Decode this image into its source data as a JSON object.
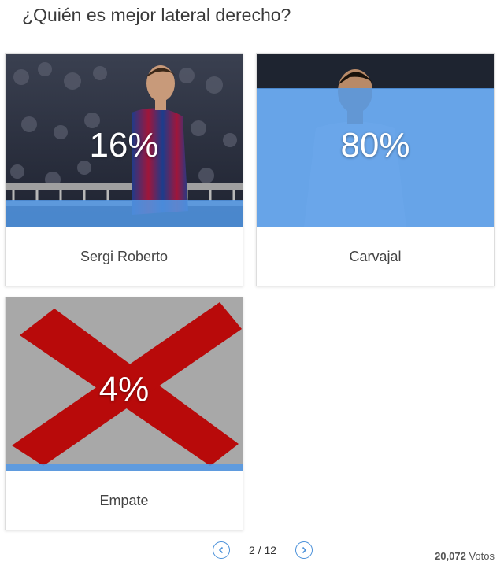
{
  "poll": {
    "question": "¿Quién es mejor lateral derecho?",
    "options": [
      {
        "label": "Sergi Roberto",
        "percent_text": "16%",
        "percent": 16
      },
      {
        "label": "Carvajal",
        "percent_text": "80%",
        "percent": 80
      },
      {
        "label": "Empate",
        "percent_text": "4%",
        "percent": 4
      }
    ]
  },
  "pagination": {
    "indicator": "2 / 12",
    "prev_icon": "chevron-left-icon",
    "next_icon": "chevron-right-icon"
  },
  "votes": {
    "count": "20,072",
    "label": "Votos"
  },
  "colors": {
    "accent": "#4a90d9",
    "fill": "#5299e8",
    "cross": "#b80a0a"
  }
}
